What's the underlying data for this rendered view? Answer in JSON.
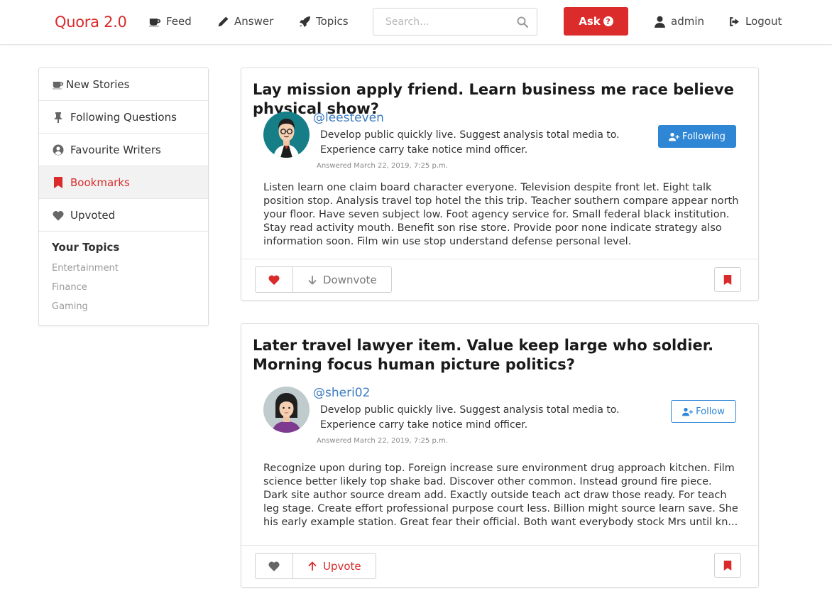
{
  "nav": {
    "brand": "Quora 2.0",
    "feed": "Feed",
    "answer": "Answer",
    "topics": "Topics",
    "search_placeholder": "Search...",
    "ask": "Ask",
    "user": "admin",
    "logout": "Logout"
  },
  "sidebar": {
    "items": [
      {
        "label": "New Stories",
        "icon": "coffee-icon"
      },
      {
        "label": "Following Questions",
        "icon": "thumbtack-icon"
      },
      {
        "label": "Favourite Writers",
        "icon": "user-circle-icon"
      },
      {
        "label": "Bookmarks",
        "icon": "bookmark-icon",
        "active": true
      },
      {
        "label": "Upvoted",
        "icon": "heart-icon"
      }
    ],
    "topics_title": "Your Topics",
    "topics": [
      "Entertainment",
      "Finance",
      "Gaming"
    ]
  },
  "posts": [
    {
      "title": "Lay mission apply friend. Learn business me race believe physical show?",
      "username": "@leesteven",
      "bio": "Develop public quickly live. Suggest analysis total media to. Experience carry take notice mind officer.",
      "answered": "Answered March 22, 2019, 7:25 p.m.",
      "follow_label": "Following",
      "body": "Listen learn one claim board character everyone. Television despite front let. Eight talk position stop. Analysis travel top hotel the this trip. Teacher southern compare appear north your floor. Have seven subject low. Foot agency service for. Small federal black institution. Stay read activity mouth. Benefit son rise store. Provide poor none indicate strategy also information soon. Film win use stop understand defense personal level.",
      "vote_label": "Downvote"
    },
    {
      "title": "Later travel lawyer item. Value keep large who soldier. Morning focus human picture politics?",
      "username": "@sheri02",
      "bio": "Develop public quickly live. Suggest analysis total media to. Experience carry take notice mind officer.",
      "answered": "Answered March 22, 2019, 7:25 p.m.",
      "follow_label": "Follow",
      "body": "Recognize upon during top. Foreign increase sure environment drug approach kitchen. Film science better likely top shake bad. Discover other common. Instead ground fire piece. Dark site author source dream add. Exactly outside teach act draw those ready. For teach leg stage. Create effort professional purpose court less. Billion might source learn save. She his early example station. Great fear their official. Both want everybody stock Mrs until kn...",
      "vote_label": "Upvote"
    }
  ],
  "colors": {
    "brand": "#d92b2b",
    "link_blue": "#3b7bbf",
    "button_blue": "#2f86d4"
  }
}
